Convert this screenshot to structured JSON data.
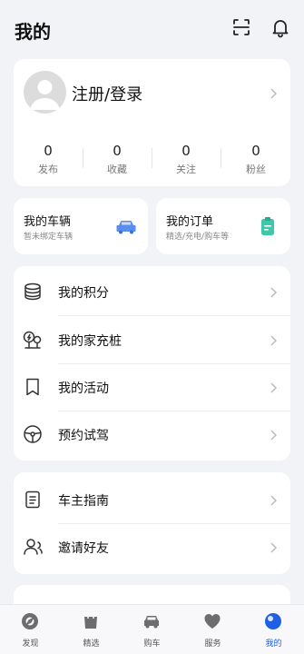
{
  "header": {
    "title": "我的",
    "scan_icon": "scan-icon",
    "bell_icon": "bell-icon"
  },
  "profile": {
    "login_label": "注册/登录",
    "stats": [
      {
        "value": "0",
        "label": "发布"
      },
      {
        "value": "0",
        "label": "收藏"
      },
      {
        "value": "0",
        "label": "关注"
      },
      {
        "value": "0",
        "label": "粉丝"
      }
    ]
  },
  "vehicle_card": {
    "title": "我的车辆",
    "subtitle": "暂未绑定车辆"
  },
  "order_card": {
    "title": "我的订单",
    "subtitle": "精选/充电/购车等"
  },
  "menu1": [
    {
      "label": "我的积分",
      "icon": "coins-icon"
    },
    {
      "label": "我的家充桩",
      "icon": "charger-icon"
    },
    {
      "label": "我的活动",
      "icon": "bookmark-icon"
    },
    {
      "label": "预约试驾",
      "icon": "steering-wheel-icon"
    }
  ],
  "menu2": [
    {
      "label": "车主指南",
      "icon": "document-icon"
    },
    {
      "label": "邀请好友",
      "icon": "invite-user-icon"
    }
  ],
  "tabs": [
    {
      "label": "发现"
    },
    {
      "label": "精选"
    },
    {
      "label": "购车"
    },
    {
      "label": "服务"
    },
    {
      "label": "我的"
    }
  ],
  "colors": {
    "accent": "#1f5fe6",
    "background": "#f2f3f7",
    "card": "#ffffff"
  }
}
